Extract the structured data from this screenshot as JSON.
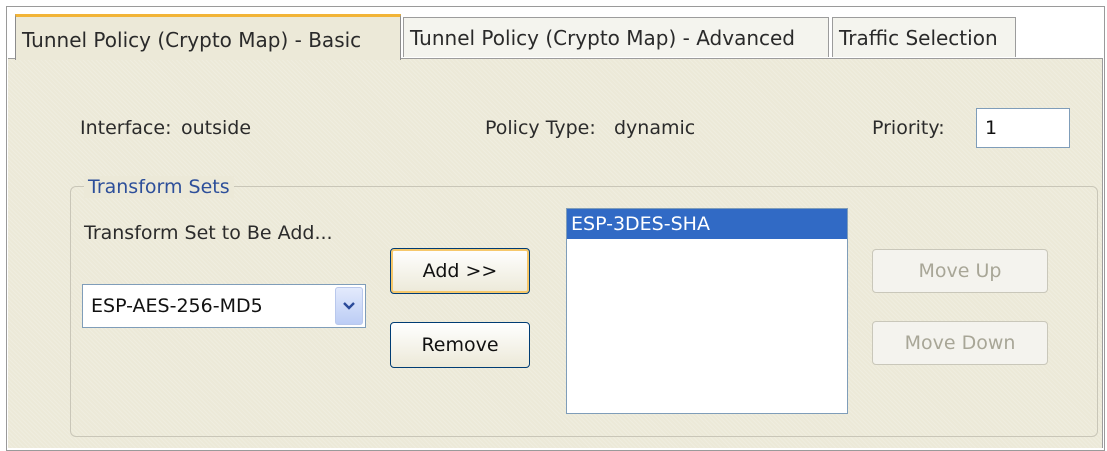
{
  "tabs": [
    {
      "label": "Tunnel Policy (Crypto Map) - Basic",
      "active": true
    },
    {
      "label": "Tunnel Policy (Crypto Map) - Advanced",
      "active": false
    },
    {
      "label": "Traffic Selection",
      "active": false
    }
  ],
  "policy": {
    "interface_label": "Interface:",
    "interface_value": "outside",
    "policy_type_label": "Policy Type:",
    "policy_type_value": "dynamic",
    "priority_label": "Priority:",
    "priority_value": "1"
  },
  "transform_sets": {
    "title": "Transform Sets",
    "to_be_added_label": "Transform Set to Be Add...",
    "selected_option": "ESP-AES-256-MD5",
    "add_button": "Add >>",
    "remove_button": "Remove",
    "list_items": [
      "ESP-3DES-SHA"
    ],
    "move_up_button": "Move Up",
    "move_down_button": "Move Down"
  },
  "colors": {
    "panel_bg": "#ece9d8",
    "active_tab_accent": "#f2b437",
    "selection": "#316ac5",
    "group_title": "#2d4f9a"
  },
  "icons": {
    "dropdown": "chevron-down-icon"
  }
}
